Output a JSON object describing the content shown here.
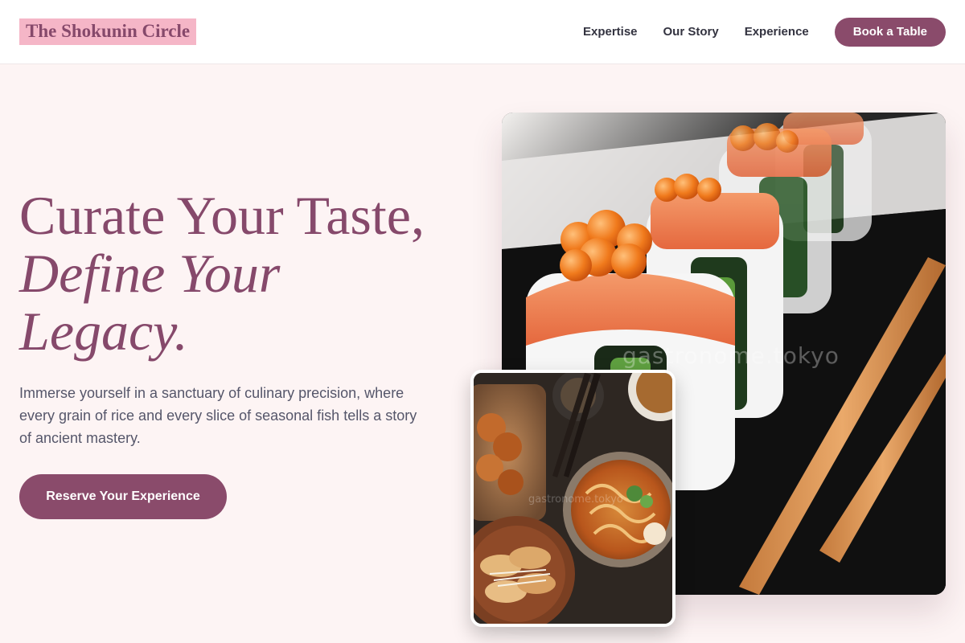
{
  "brand": {
    "logo_text": "The Shokunin Circle"
  },
  "nav": {
    "links": [
      {
        "label": "Expertise"
      },
      {
        "label": "Our Story"
      },
      {
        "label": "Experience"
      }
    ],
    "cta_label": "Book a Table"
  },
  "hero": {
    "title_line1": "Curate Your Taste,",
    "title_line2": "Define Your",
    "title_line3": "Legacy.",
    "description": "Immerse yourself in a sanctuary of culinary precision, where every grain of rice and every slice of seasonal fish tells a story of ancient mastery.",
    "cta_label": "Reserve Your Experience"
  },
  "images": {
    "main_watermark": "gastronome.tokyo",
    "secondary_watermark": "gastronome.tokyo",
    "main_icon": "sushi-rolls-photo",
    "secondary_icon": "japanese-food-tray-photo"
  },
  "colors": {
    "accent": "#8a4b6b",
    "logo_highlight": "#f5b6c7",
    "page_background": "#fdf4f4"
  }
}
